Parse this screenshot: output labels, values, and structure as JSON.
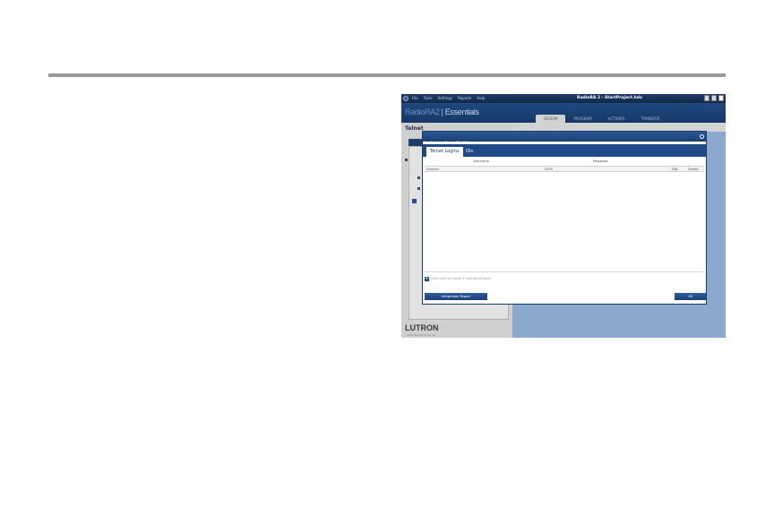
{
  "window": {
    "title": "RadioRA 2 - StartProject.hdx",
    "menu": [
      "File",
      "Tools",
      "Settings",
      "Reports",
      "Help"
    ]
  },
  "header": {
    "brand_prefix": "RadioRA",
    "brand_suffix": "2",
    "brand_sep": "|",
    "brand_edition": "Essentials",
    "tabs": [
      "DESIGN",
      "PROGRAM",
      "ACTIVATE",
      "TRANSFER"
    ]
  },
  "left_panel": {
    "heading": "Telnet",
    "tab_label": "Rea"
  },
  "dialog": {
    "title": "Integration Settings",
    "tabs": {
      "telnet_logins": "Telnet Logins",
      "ids": "IDs"
    },
    "columns_top": {
      "username": "Username",
      "password": "Password"
    },
    "columns": {
      "number": "Number",
      "level": "LEVR",
      "edit": "Edit",
      "delete": "Delete"
    },
    "add_hint": "Click here to create a new telnet login",
    "buttons": {
      "report": "Integration Report",
      "ok": "OK"
    }
  },
  "footer": {
    "logo": "LUTRON",
    "sub": "Lutron Electronics Co., Inc."
  },
  "colors": {
    "accent": "#1e4a86",
    "titlebar": "#1d3b66",
    "background_blue": "#8aa9cc"
  }
}
